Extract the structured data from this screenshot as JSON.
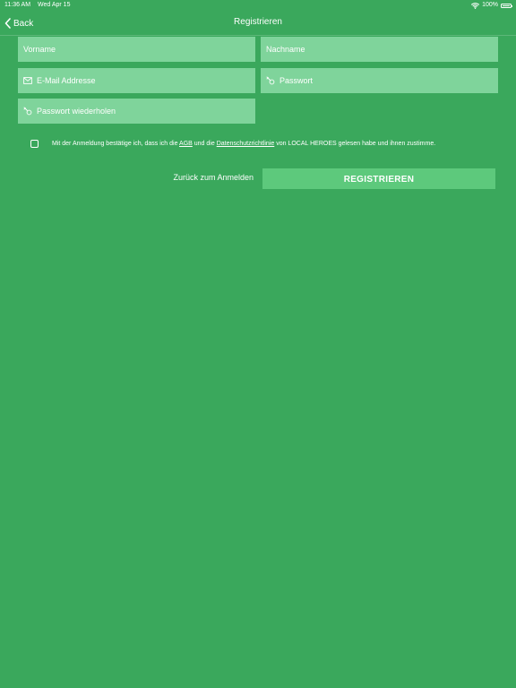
{
  "status_bar": {
    "time": "11:36 AM",
    "date": "Wed Apr 15",
    "battery": "100%",
    "battery_level": 1.0
  },
  "nav": {
    "back_label": "Back",
    "title": "Registrieren"
  },
  "form": {
    "vorname_placeholder": "Vorname",
    "nachname_placeholder": "Nachname",
    "email_placeholder": "E-Mail Addresse",
    "email_icon": "envelope-icon",
    "passwort_placeholder": "Passwort",
    "passwort_icon": "key-icon",
    "passwort_repeat_placeholder": "Passwort wiederholen",
    "passwort_repeat_icon": "key-icon"
  },
  "terms": {
    "checked": false,
    "text_before": "Mit der Anmeldung bestätige ich, dass ich die ",
    "agb_link": "AGB",
    "text_middle": " und die ",
    "privacy_link": "Datenschutzrichtlinie",
    "text_after": " von LOCAL HEROES gelesen habe und ihnen zustimme."
  },
  "actions": {
    "back_to_login": "Zurück zum Anmelden",
    "register": "REGISTRIEREN"
  },
  "colors": {
    "background": "#3aa85c",
    "field": "#7fd49b",
    "button": "#5dc97c",
    "text": "#ffffff"
  }
}
